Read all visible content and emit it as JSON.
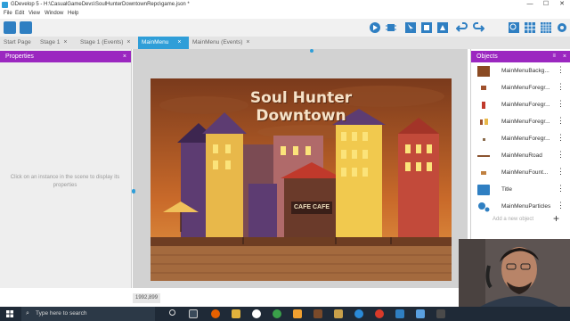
{
  "window": {
    "title": "GDevelop 5 - H:\\CasualGameDevs\\SoulHunterDowntownRepo\\game.json *",
    "controls": [
      "—",
      "☐",
      "✕"
    ]
  },
  "menubar": {
    "items": [
      "File",
      "Edit",
      "View",
      "Window",
      "Help"
    ]
  },
  "toolbar": {
    "icons": [
      "play-icon",
      "debug-icon",
      "select-icon",
      "layers-icon",
      "instances-icon",
      "undo-icon",
      "redo-icon",
      "zoom-icon",
      "grid-icon",
      "settings-icon"
    ]
  },
  "tabs": [
    {
      "label": "Start Page",
      "active": false,
      "closable": false
    },
    {
      "label": "Stage 1",
      "active": false,
      "closable": true
    },
    {
      "label": "Stage 1 (Events)",
      "active": false,
      "closable": true
    },
    {
      "label": "MainMenu",
      "active": true,
      "closable": true
    },
    {
      "label": "MainMenu (Events)",
      "active": false,
      "closable": true
    }
  ],
  "properties": {
    "title": "Properties",
    "close": "×",
    "empty_message": "Click on an instance in the scene to display its properties"
  },
  "scene": {
    "game_title_line1": "Soul Hunter",
    "game_title_line2": "Downtown",
    "cafe_sign": "CAFE CAFE",
    "coords": "1992,899"
  },
  "objects": {
    "title": "Objects",
    "close": "×",
    "items": [
      {
        "name": "MainMenuBackg...",
        "icon": "background-sprite-icon"
      },
      {
        "name": "MainMenuForegr...",
        "icon": "foreground-sprite-icon"
      },
      {
        "name": "MainMenuForegr...",
        "icon": "foreground-sprite-icon"
      },
      {
        "name": "MainMenuForegr...",
        "icon": "foreground-sprite-icon"
      },
      {
        "name": "MainMenuForegr...",
        "icon": "foreground-sprite-icon"
      },
      {
        "name": "MainMenuRoad",
        "icon": "road-sprite-icon"
      },
      {
        "name": "MainMenuFount...",
        "icon": "fountain-sprite-icon"
      },
      {
        "name": "Title",
        "icon": "text-object-icon"
      },
      {
        "name": "MainMenuParticles",
        "icon": "particles-icon"
      }
    ],
    "add_placeholder": "Add a new object",
    "add_symbol": "+"
  },
  "taskbar": {
    "search_placeholder": "Type here to search"
  },
  "colors": {
    "accent_purple": "#9b27c0",
    "tab_active": "#2f9ed8",
    "taskbar": "#1f2a37"
  }
}
